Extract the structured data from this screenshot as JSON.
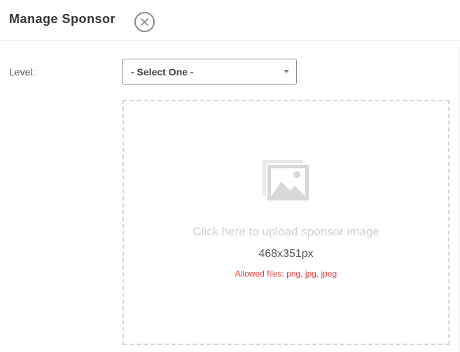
{
  "modal": {
    "title": "Manage Sponsor"
  },
  "form": {
    "level_label": "Level:",
    "level_select": {
      "selected": "- Select One -"
    },
    "upload": {
      "prompt": "Click here to upload sponsor image",
      "dimensions": "468x351px",
      "allowed": "Allowed files: png, jpg, jpeg"
    }
  },
  "icons": {
    "close": "close-icon",
    "image_placeholder": "image-icon",
    "dropdown": "chevron-down-icon"
  },
  "colors": {
    "allowed_text": "#e03b3b",
    "prompt_text": "#cfcfcf",
    "icon_gray": "#d8d8d8",
    "dashed_border": "#d5d5d5"
  }
}
